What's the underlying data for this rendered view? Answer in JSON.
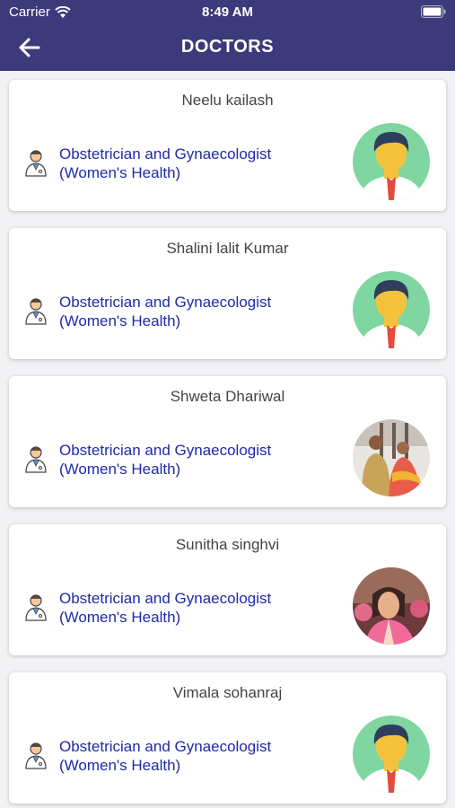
{
  "status_bar": {
    "carrier": "Carrier",
    "time": "8:49 AM"
  },
  "header": {
    "title": "DOCTORS"
  },
  "doctors": [
    {
      "name": "Neelu kailash",
      "specialty_line1": "Obstetrician and Gynaecologist",
      "specialty_line2": "(Women's Health)",
      "avatar": "default-male-avatar"
    },
    {
      "name": "Shalini lalit Kumar",
      "specialty_line1": "Obstetrician and Gynaecologist",
      "specialty_line2": "(Women's Health)",
      "avatar": "default-male-avatar"
    },
    {
      "name": "Shweta Dhariwal",
      "specialty_line1": "Obstetrician and Gynaecologist",
      "specialty_line2": "(Women's Health)",
      "avatar": "couple-photo"
    },
    {
      "name": "Sunitha singhvi",
      "specialty_line1": "Obstetrician and Gynaecologist",
      "specialty_line2": "(Women's Health)",
      "avatar": "woman-photo"
    },
    {
      "name": "Vimala sohanraj",
      "specialty_line1": "Obstetrician and Gynaecologist",
      "specialty_line2": "(Women's Health)",
      "avatar": "default-male-avatar"
    }
  ],
  "colors": {
    "header_bg": "#3c3a7a",
    "specialty_text": "#1f2aa8",
    "name_text": "#444444",
    "avatar_bg": "#7fd6a0"
  }
}
